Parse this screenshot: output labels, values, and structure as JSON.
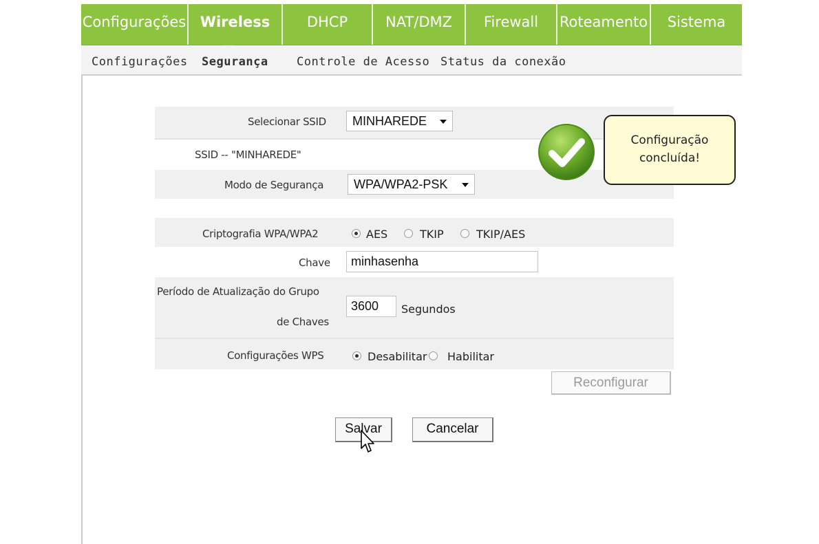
{
  "top_nav": {
    "tabs": [
      {
        "label": "Configurações",
        "active": false
      },
      {
        "label": "Wireless",
        "active": true
      },
      {
        "label": "DHCP",
        "active": false
      },
      {
        "label": "NAT/DMZ",
        "active": false
      },
      {
        "label": "Firewall",
        "active": false
      },
      {
        "label": "Roteamento",
        "active": false
      },
      {
        "label": "Sistema",
        "active": false
      }
    ],
    "accent_color": "#8cc33f"
  },
  "sub_nav": {
    "items": [
      {
        "label": "Configurações",
        "active": false
      },
      {
        "label": "Segurança",
        "active": true
      },
      {
        "label": "Controle de Acesso",
        "active": false
      },
      {
        "label": "Status da conexão",
        "active": false
      }
    ]
  },
  "form": {
    "select_ssid_label": "Selecionar SSID",
    "select_ssid_value": "MINHAREDE",
    "ssid_heading": "SSID -- \"MINHAREDE\"",
    "security_mode_label": "Modo de Segurança",
    "security_mode_value": "WPA/WPA2-PSK",
    "encryption_label": "Criptografia WPA/WPA2",
    "encryption_options": [
      {
        "label": "AES",
        "checked": true
      },
      {
        "label": "TKIP",
        "checked": false
      },
      {
        "label": "TKIP/AES",
        "checked": false
      }
    ],
    "key_label": "Chave",
    "key_value": "minhasenha",
    "group_key_label_line1": "Período de Atualização do Grupo",
    "group_key_label_line2": "de Chaves",
    "group_key_value": "3600",
    "group_key_unit": "Segundos",
    "wps_label": "Configurações WPS",
    "wps_options": [
      {
        "label": "Desabilitar",
        "checked": true
      },
      {
        "label": "Habilitar",
        "checked": false
      }
    ],
    "reconfigure_label": "Reconfigurar",
    "save_label": "Salvar",
    "cancel_label": "Cancelar"
  },
  "overlay": {
    "bubble_line1": "Configuração",
    "bubble_line2": "concluída!",
    "check_icon": "checkmark-icon",
    "check_color": "#6aa62a",
    "bubble_color": "#fefbd5"
  }
}
